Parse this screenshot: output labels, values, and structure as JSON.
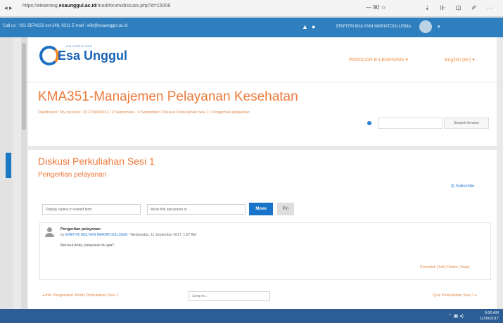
{
  "browser": {
    "url_prefix": "https://elearning.",
    "url_host": "esaunggul.ac.id",
    "url_path": "/mod/forum/discuss.php?d=15008",
    "zoom": "— 90 ☆",
    "tools": "⇣ ⊪ ⊡ ✐ ⋯"
  },
  "infobar": {
    "contact": "Call us : 021-5674223 ext 248, 6311 E-mail : elib@esaunggul.ac.id",
    "user": "ERIFITRI MULYANI MARIATOOLUSMA",
    "bell_icon": "bell-icon",
    "message_icon": "message-icon"
  },
  "header": {
    "logo_small": "UNIVERSITAS",
    "logo_name": "Esa Unggul",
    "panduan": "PANDUAN E-LEARNING ▾",
    "lang": "English (en) ▾"
  },
  "course": {
    "title": "KMA351-Manajemen Pelayanan Kesehatan",
    "breadcrumb": "Dashboard / My courses / 20171KMA351 / 3 September - 9 September / Diskusi Perkuliahan Sesi 1 / Pengertian pelayanan",
    "search_button": "Search forums"
  },
  "discussion": {
    "title": "Diskusi Perkuliahan Sesi 1",
    "subtitle": "Pengertian pelayanan",
    "subscribe": "⊟ Subscribe",
    "display_mode": "Display replies in nested form",
    "move_select": "Move this discussion to ...",
    "move_button": "Move",
    "pin_button": "Pin"
  },
  "post": {
    "subject": "Pengertian pelayanan",
    "meta_prefix": "by ",
    "author": "ERIFITRI MULYANI MARIATOOLUSMA",
    "meta_date": " - Wednesday, 11 September 2017, 1:07 AM",
    "message": "Menurut Anda, pelayanan itu apa?",
    "actions": "Permalink | Edit | Delete | Reply"
  },
  "nav": {
    "prev": "◂ Info Pengenalan Modul Perkuliahan Sesi 1",
    "jump": "Jump to...",
    "next": "Quiz Perkuliahan Sesi 1 ▸"
  },
  "taskbar": {
    "tray": "⌃ ▣ ◂)",
    "time": "9:00 AM",
    "date": "11/09/2017"
  }
}
